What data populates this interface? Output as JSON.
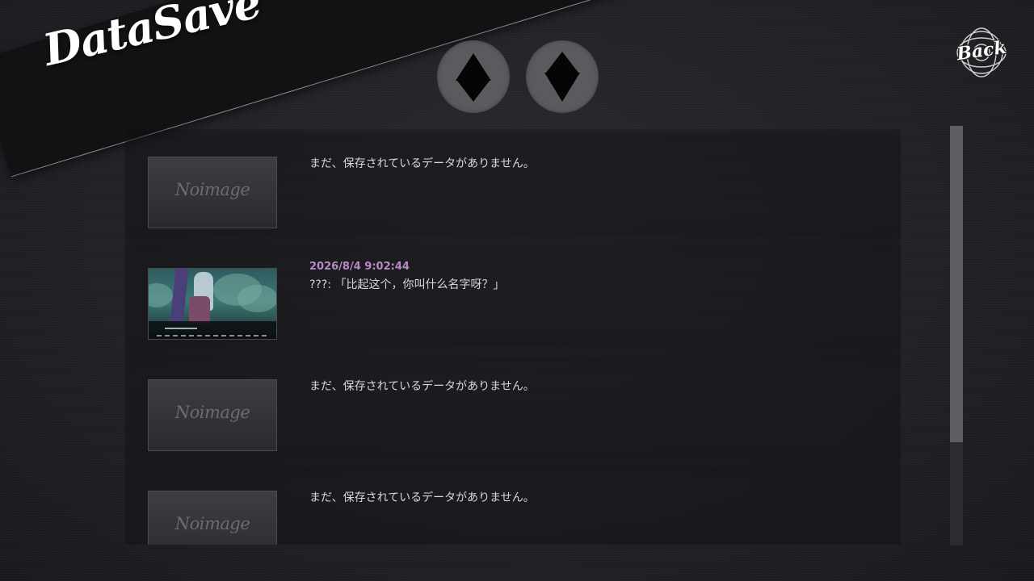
{
  "header": {
    "title": "DataSave",
    "back_label": "Back"
  },
  "nav": {
    "up_icon": "arrow-up-icon",
    "down_icon": "arrow-down-icon"
  },
  "slots": [
    {
      "empty": true,
      "placeholder": "Noimage",
      "text": "まだ、保存されているデータがありません。"
    },
    {
      "empty": false,
      "date": "2026/8/4 9:02:44",
      "message": "???: 「比起这个，你叫什么名字呀？」"
    },
    {
      "empty": true,
      "placeholder": "Noimage",
      "text": "まだ、保存されているデータがありません。"
    },
    {
      "empty": true,
      "placeholder": "Noimage",
      "text": "まだ、保存されているデータがありません。"
    }
  ],
  "colors": {
    "accent_date": "#b58bc4",
    "background": "#222227",
    "button": "#5b5b5f"
  }
}
